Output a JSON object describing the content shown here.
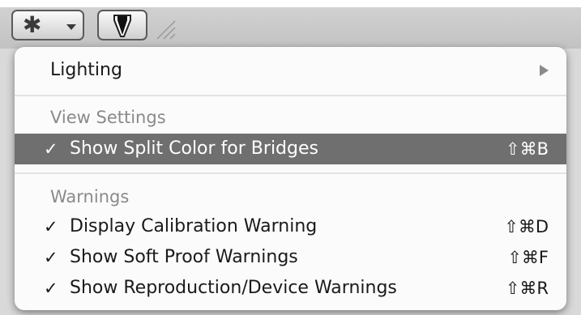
{
  "toolbar": {
    "gear_icon": "gear-icon",
    "gear_glyph": "✱",
    "proof_icon": "soft-proof-icon"
  },
  "menu": {
    "lighting": {
      "label": "Lighting",
      "has_submenu": true
    },
    "view_settings": {
      "header": "View Settings",
      "items": [
        {
          "check": "✓",
          "label": "Show Split Color for Bridges",
          "shortcut": "⇧⌘B",
          "checked": true,
          "highlighted": true
        }
      ]
    },
    "warnings": {
      "header": "Warnings",
      "items": [
        {
          "check": "✓",
          "label": "Display Calibration Warning",
          "shortcut": "⇧⌘D",
          "checked": true
        },
        {
          "check": "✓",
          "label": "Show Soft Proof Warnings",
          "shortcut": "⇧⌘F",
          "checked": true
        },
        {
          "check": "✓",
          "label": "Show Reproduction/Device Warnings",
          "shortcut": "⇧⌘R",
          "checked": true
        }
      ]
    }
  },
  "colors": {
    "menu_bg": "#fbfbfb",
    "highlight_bg": "#6f6f6f",
    "section_header": "#8a8a8a"
  }
}
